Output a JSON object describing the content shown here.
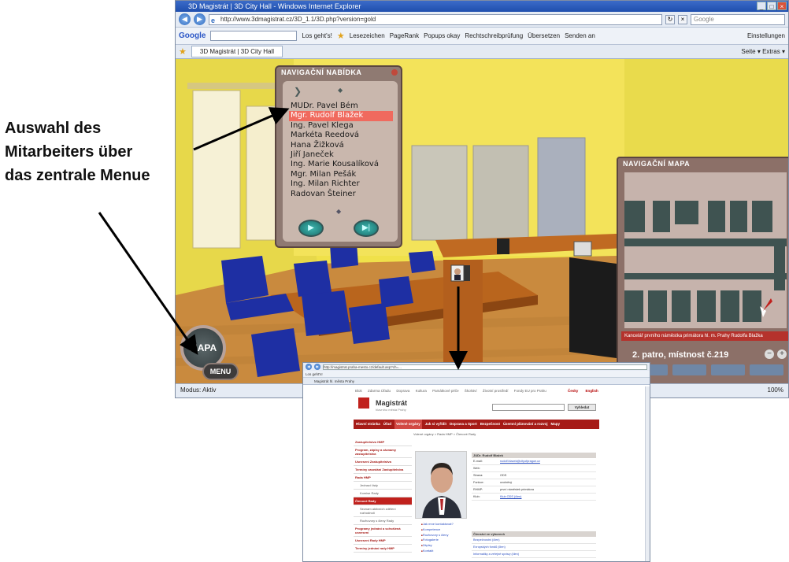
{
  "annotation": {
    "lines": [
      "Auswahl des",
      "Mitarbeiters über",
      "das zentrale Menue"
    ]
  },
  "browser": {
    "title": "3D Magistrát | 3D City Hall - Windows Internet Explorer",
    "url": "http://www.3dmagistrat.cz/3D_1.1/3D.php?version=gold",
    "search_placeholder": "Google",
    "google_toolbar": [
      "Los geht's!",
      "Lesezeichen",
      "PageRank",
      "Popups okay",
      "Rechtschreibprüfung",
      "Übersetzen",
      "Senden an"
    ],
    "google_right": "Einstellungen",
    "tab_title": "3D Magistrát | 3D City Hall",
    "right_tools": "Seite ▾  Extras ▾",
    "status_right": "100%",
    "status_mode": "Modus: Aktiv"
  },
  "nav_menu": {
    "title": "NAVIGAČNÍ NABÍDKA",
    "items": [
      "MUDr. Pavel Bém",
      "Mgr. Rudolf Blažek",
      "Ing. Pavel Klega",
      "Markéta Reedová",
      "Hana Žižková",
      "Jiří Janeček",
      "Ing. Marie Kousalíková",
      "Mgr. Milan Pešák",
      "Ing. Milan Richter",
      "Radovan Šteiner"
    ],
    "selected_index": 1
  },
  "nav_map": {
    "title": "NAVIGAČNÍ MAPA",
    "caption": "Kancelář prvního náměstka primátora hl. m. Prahy Rudolfa Blažka",
    "floor": "2. patro, místnost č.219"
  },
  "buttons": {
    "mapa": "MAPA",
    "menu": "MENU"
  },
  "website": {
    "url": "http://magistrat.praha-mesto.cz/default.asp?ch=...",
    "tab_title": "Magistrát hl. města Prahy",
    "topnav": [
      "Blok",
      "Zdarma Úřadu",
      "Doprava",
      "Kultura",
      "Památkové péče",
      "Školství",
      "Životní prostředí",
      "Fondy EU pro Prahu"
    ],
    "langs": [
      "Česky",
      "English"
    ],
    "logo_title": "Magistrát",
    "logo_sub": "hlavního města Prahy",
    "search_button": "Vyhledat",
    "main_nav": [
      "Hlavní stránka",
      "Úřad",
      "Volené orgány",
      "Jak si vyřídit",
      "Doprava a Sport",
      "Bezpečnost",
      "Územní plánování a rozvoj",
      "Mapy"
    ],
    "active_nav": 2,
    "breadcrumb": "Volené orgány > Rada HMP > Členové Rady",
    "sidebar": [
      {
        "label": "Zastupitelstvo HMP",
        "type": "head"
      },
      {
        "label": "Program, zápisy a záznamy zastupitelstva",
        "type": "head"
      },
      {
        "label": "Usnesení Zastupitelstva",
        "type": "head"
      },
      {
        "label": "Termíny zasedání Zastupitelstva",
        "type": "head"
      },
      {
        "label": "Rada HMP",
        "type": "head"
      },
      {
        "label": "Jednací řády",
        "type": "sub"
      },
      {
        "label": "Komise Rady",
        "type": "sub"
      },
      {
        "label": "Členové Rady",
        "type": "sel"
      },
      {
        "label": "Seznam aktivních zdělení rozhodnutí",
        "type": "sub"
      },
      {
        "label": "Rozhovory s členy Rady",
        "type": "sub"
      },
      {
        "label": "Programy jednání a schválená usnesení",
        "type": "head"
      },
      {
        "label": "Usnesení Rady HMP",
        "type": "head"
      },
      {
        "label": "Termíny jednání rady HMP",
        "type": "head"
      }
    ],
    "profile_head": "JUDr. Rudolf Blažek",
    "profile_rows": [
      {
        "k": "E-mail:",
        "v": "rudolf.blazek@cityofprague.cz",
        "link": true
      },
      {
        "k": "Web:",
        "v": "",
        "link": false
      },
      {
        "k": "Strana:",
        "v": "ODS",
        "link": false
      },
      {
        "k": "Funkce:",
        "v": "uvolněný",
        "link": false
      },
      {
        "k": "RHMP:",
        "v": "první náměstek primátora",
        "link": false
      },
      {
        "k": "Klub:",
        "v": "Klub ODS (člen)",
        "link": true
      }
    ],
    "links": [
      "Jak mne kontaktovat?",
      "Kompetence",
      "Rozhovory s členy",
      "Fotogalerie",
      "Zápisy",
      "Kontakt"
    ],
    "boards_head": "Členství ve výborech",
    "boards": [
      "Bezpečnostní (člen)",
      "Evropských fondů (člen)",
      "Informatiky a veřejné správy (člen)"
    ]
  }
}
